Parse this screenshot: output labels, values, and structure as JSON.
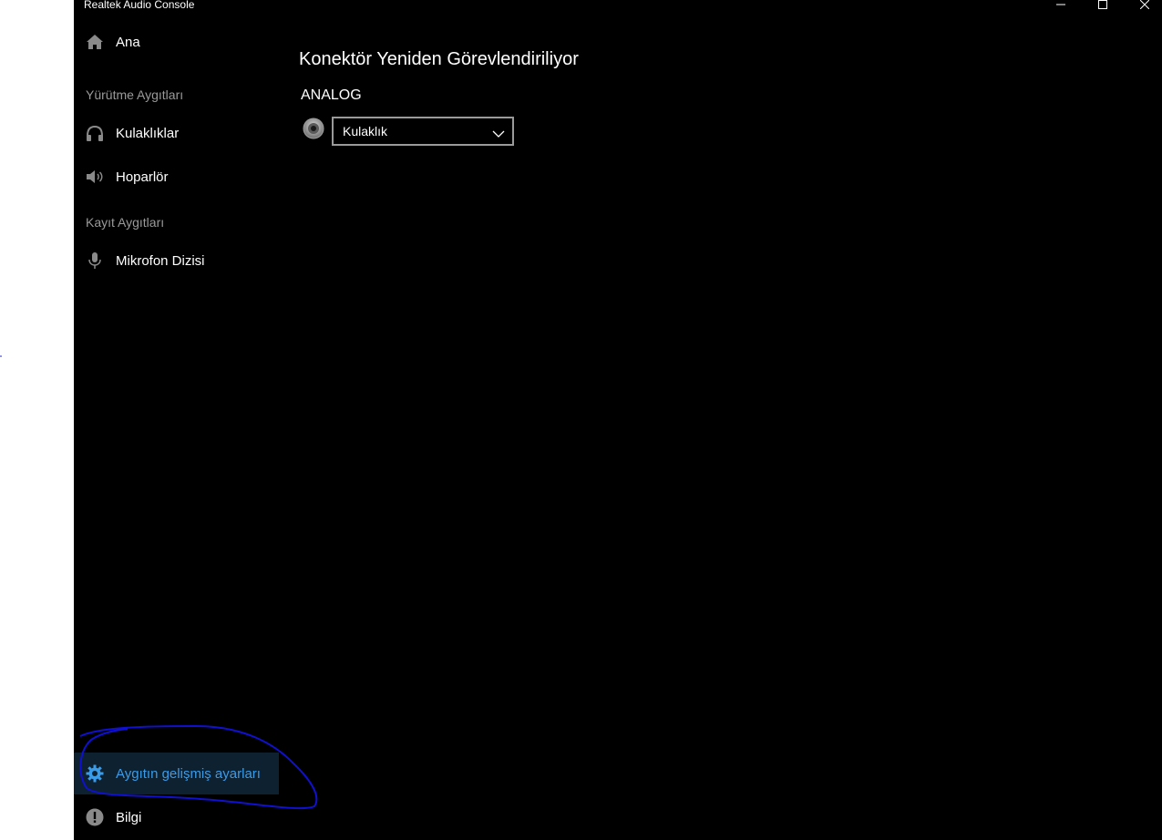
{
  "window": {
    "title": "Realtek Audio Console",
    "controls": {
      "minimize_icon": "minimize-icon",
      "maximize_icon": "maximize-icon",
      "close_icon": "close-icon"
    }
  },
  "sidebar": {
    "home": {
      "label": "Ana",
      "icon": "home-icon"
    },
    "playback_section": "Yürütme Aygıtları",
    "playback_items": [
      {
        "label": "Kulaklıklar",
        "icon": "headphones-icon"
      },
      {
        "label": "Hoparlör",
        "icon": "speaker-icon"
      }
    ],
    "recording_section": "Kayıt Aygıtları",
    "recording_items": [
      {
        "label": "Mikrofon Dizisi",
        "icon": "microphone-icon"
      }
    ],
    "advanced": {
      "label": "Aygıtın gelişmiş ayarları",
      "icon": "gear-icon",
      "selected": true
    },
    "info": {
      "label": "Bilgi",
      "icon": "info-icon"
    }
  },
  "main": {
    "title": "Konektör Yeniden Görevlendiriliyor",
    "group_label": "ANALOG",
    "connector": {
      "icon": "audio-jack-icon",
      "selected_value": "Kulaklık"
    }
  },
  "colors": {
    "background": "#000000",
    "accent": "#3a9be8",
    "selected_bg": "#0d2130",
    "annotation": "#1010d0"
  }
}
